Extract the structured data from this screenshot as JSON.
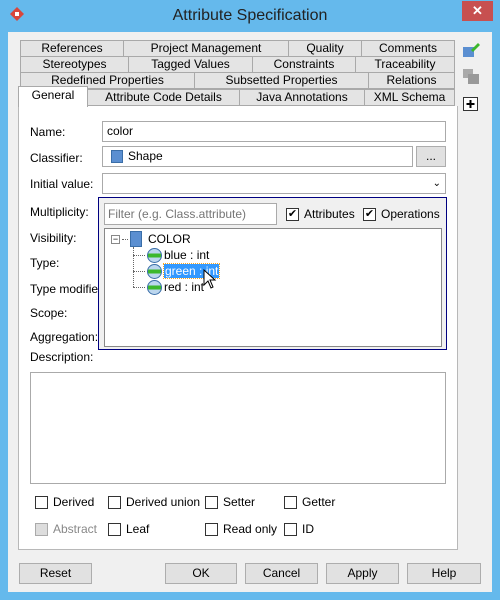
{
  "window": {
    "title": "Attribute Specification",
    "close_icon": "close-icon"
  },
  "tabs": {
    "row1": [
      "References",
      "Project Management",
      "Quality",
      "Comments"
    ],
    "row2": [
      "Stereotypes",
      "Tagged Values",
      "Constraints",
      "Traceability"
    ],
    "row3": [
      "Redefined Properties",
      "Subsetted Properties",
      "Relations"
    ],
    "row4": [
      "General",
      "Attribute Code Details",
      "Java Annotations",
      "XML Schema"
    ],
    "selected": "General"
  },
  "form": {
    "name_label": "Name:",
    "name_value": "color",
    "classifier_label": "Classifier:",
    "classifier_value": "Shape",
    "browse_label": "...",
    "initial_value_label": "Initial value:",
    "initial_value": "",
    "multiplicity_label": "Multiplicity:",
    "visibility_label": "Visibility:",
    "type_label": "Type:",
    "type_modifier_label": "Type modifier:",
    "scope_label": "Scope:",
    "aggregation_label": "Aggregation:",
    "description_label": "Description:"
  },
  "popup": {
    "filter_placeholder": "Filter (e.g. Class.attribute)",
    "attributes_label": "Attributes",
    "attributes_checked": true,
    "operations_label": "Operations",
    "operations_checked": true,
    "tree": {
      "root": "COLOR",
      "children": [
        "blue : int",
        "green : int",
        "red : int"
      ],
      "selected": "green : int"
    }
  },
  "checkboxes": {
    "row1": [
      {
        "label": "Derived",
        "checked": false
      },
      {
        "label": "Derived union",
        "checked": false
      },
      {
        "label": "Setter",
        "checked": false
      },
      {
        "label": "Getter",
        "checked": false
      }
    ],
    "row2": [
      {
        "label": "Abstract",
        "checked": false,
        "disabled": true
      },
      {
        "label": "Leaf",
        "checked": false
      },
      {
        "label": "Read only",
        "checked": false
      },
      {
        "label": "ID",
        "checked": false
      }
    ]
  },
  "buttons": {
    "reset": "Reset",
    "ok": "OK",
    "cancel": "Cancel",
    "apply": "Apply",
    "help": "Help"
  },
  "colors": {
    "title_bar": "#65b9ec",
    "close": "#c75050",
    "selection": "#3399ff",
    "popup_border": "#000080"
  }
}
